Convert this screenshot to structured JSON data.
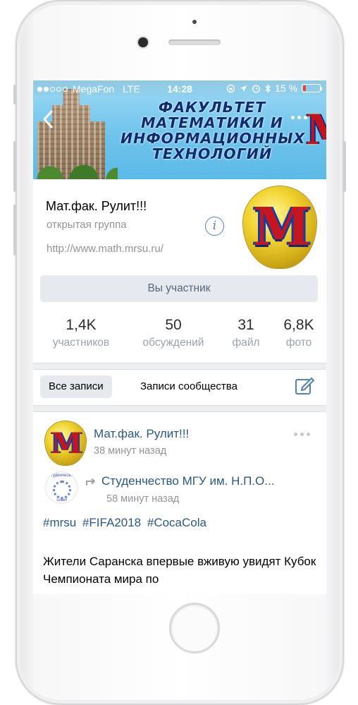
{
  "status_bar": {
    "carrier": "MegaFon",
    "network": "LTE",
    "time": "14:28",
    "battery": "15 %"
  },
  "cover": {
    "title": "ФАКУЛЬТЕТ МАТЕМАТИКИ И ИНФОРМАЦИОННЫХ ТЕХНОЛОГИЙ"
  },
  "group": {
    "name": "Мат.фак. Рулит!!!",
    "type": "открытая группа",
    "link": "http://www.math.mrsu.ru/",
    "member_button": "Вы участник"
  },
  "stats": [
    {
      "value": "1,4K",
      "label": "участников"
    },
    {
      "value": "50",
      "label": "обсуждений"
    },
    {
      "value": "31",
      "label": "файл"
    },
    {
      "value": "6,8K",
      "label": "фото"
    }
  ],
  "wall_tabs": {
    "all": "Все записи",
    "community": "Записи сообщества"
  },
  "post": {
    "author": "Мат.фак. Рулит!!!",
    "time": "38 минут назад",
    "repost": {
      "author": "Студенчество МГУ им. Н.П.О...",
      "time": "58 минут назад"
    },
    "hashtags": [
      "#mrsu",
      "#FIFA2018",
      "#CocaCola"
    ],
    "text": "Жители Саранска впервые вживую увидят Кубок Чемпионата мира по"
  },
  "colors": {
    "link": "#2a5885",
    "secondary_text": "#909499",
    "button_bg": "#e6e9ee",
    "accent": "#5181b8"
  }
}
